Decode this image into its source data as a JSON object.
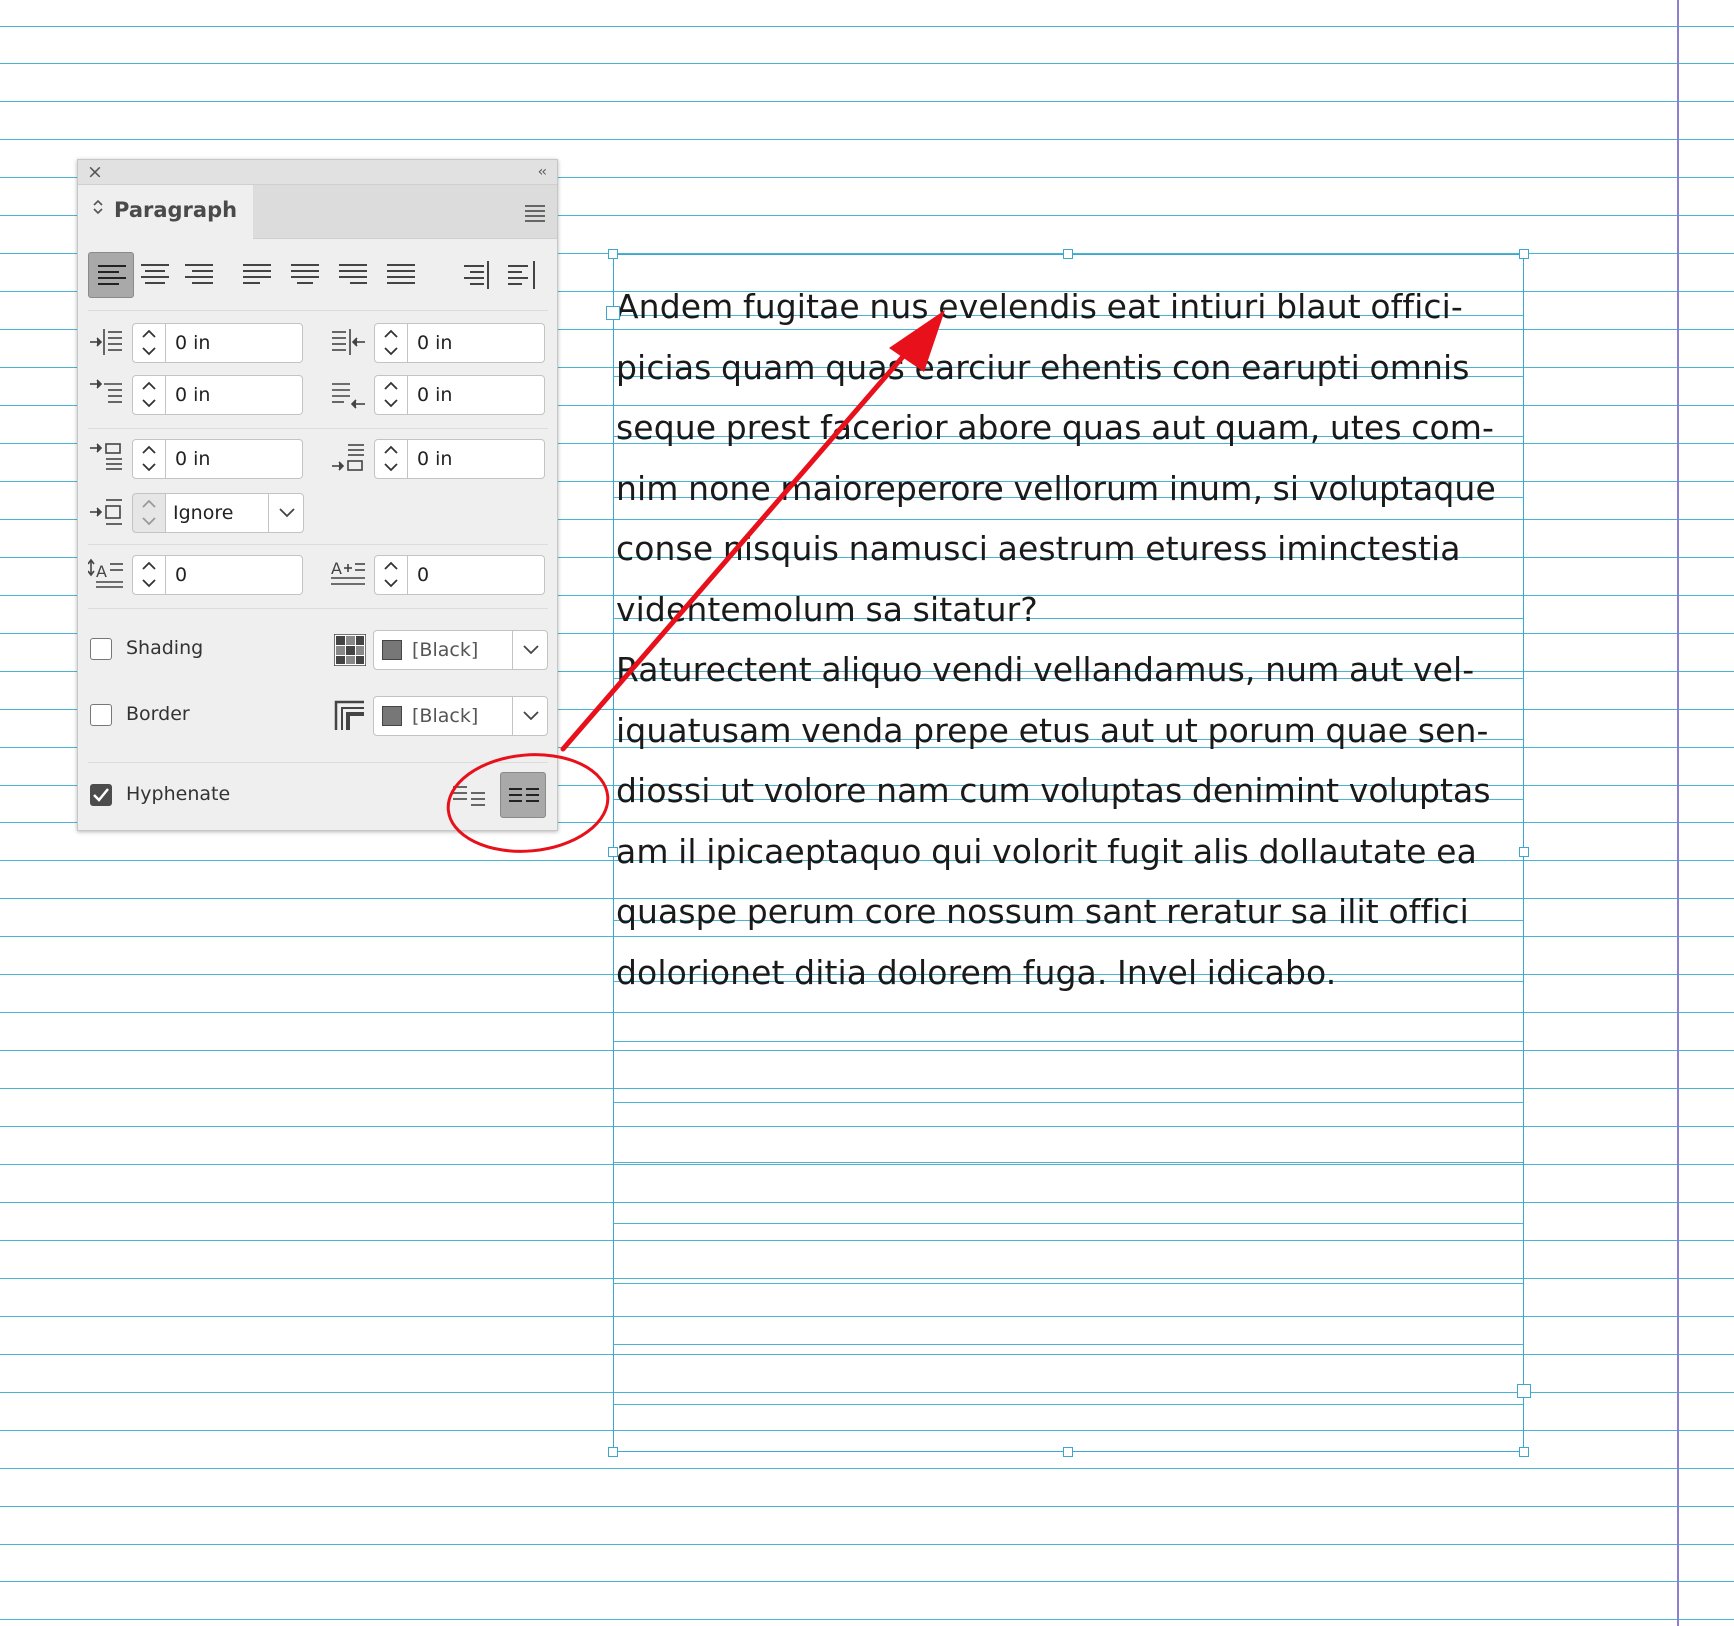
{
  "panel": {
    "close_glyph": "×",
    "collapse_glyph": "‹‹",
    "tab_label": "Paragraph",
    "alignment": {
      "buttons": [
        "align-left",
        "align-center",
        "align-right",
        "justify-left",
        "justify-center",
        "justify-right",
        "justify-all",
        "align-towards-spine",
        "align-away-from-spine"
      ],
      "selected": "align-left"
    },
    "indents": {
      "left_indent": "0 in",
      "right_indent": "0 in",
      "first_line_indent": "0 in",
      "last_line_indent": "0 in"
    },
    "spacing": {
      "space_before": "0 in",
      "space_after": "0 in",
      "align_to_grid": "Ignore"
    },
    "drop_cap": {
      "lines": "0",
      "characters": "0"
    },
    "shading": {
      "label": "Shading",
      "checked": false,
      "swatch": "[Black]",
      "color": "#777777"
    },
    "border": {
      "label": "Border",
      "checked": false,
      "swatch": "[Black]",
      "color": "#777777"
    },
    "hyphenate": {
      "label": "Hyphenate",
      "checked": true
    },
    "span_mode": {
      "selected": "span-columns"
    }
  },
  "text_frame": {
    "lines": [
      "Andem fugitae nus evelendis eat intiuri blaut offici-",
      "picias quam quas earciur ehentis con earupti omnis",
      "seque prest facerior abore quas aut quam, utes com-",
      "nim none maioreperore vellorum inum, si voluptaque",
      "conse nisquis namusci aestrum eturess iminctestia",
      "videntemolum sa sitatur?",
      "Raturectent aliquo vendi vellandamus, num aut vel-",
      "iquatusam venda prepe etus aut ut porum quae sen-",
      "diossi ut volore nam cum voluptas denimint voluptas",
      "am il ipicaeptaquo qui volorit fugit alis dollautate ea",
      "quaspe perum core nossum sant reratur sa ilit offici",
      "dolorionet ditia dolorem fuga. Invel idicabo."
    ]
  },
  "colors": {
    "baseline_grid": "#48b6d3",
    "margin_guide": "#8b7fd6",
    "annotation": "#e8101a"
  }
}
